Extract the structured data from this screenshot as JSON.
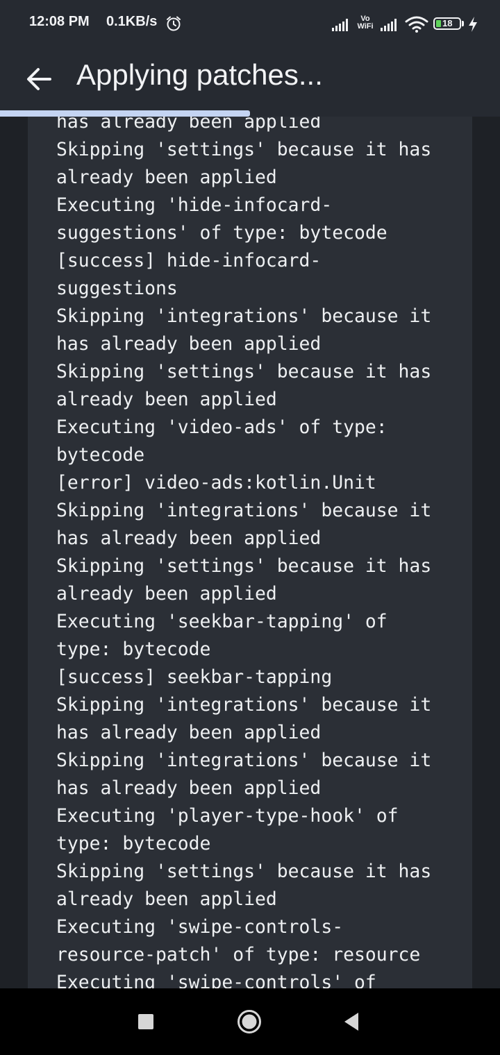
{
  "status_bar": {
    "time": "12:08 PM",
    "net_speed": "0.1KB/s",
    "vowifi_top": "Vo",
    "vowifi_bottom": "WiFi",
    "battery_level": "18",
    "icons": [
      "alarm-icon",
      "signal-icon",
      "vowifi-icon",
      "signal-icon",
      "wifi-icon",
      "battery-icon",
      "charging-icon"
    ]
  },
  "app_bar": {
    "title": "Applying patches...",
    "back_icon": "arrow-back-icon"
  },
  "progress": {
    "fraction": 0.5
  },
  "log_lines": [
    "has already been applied",
    "Skipping 'settings' because it has",
    "already been applied",
    "Executing 'hide-infocard-",
    "suggestions' of type: bytecode",
    "[success] hide-infocard-",
    "suggestions",
    "Skipping 'integrations' because it",
    "has already been applied",
    "Skipping 'settings' because it has",
    "already been applied",
    "Executing 'video-ads' of type:",
    "bytecode",
    "[error] video-ads:kotlin.Unit",
    "Skipping 'integrations' because it",
    "has already been applied",
    "Skipping 'settings' because it has",
    "already been applied",
    "Executing 'seekbar-tapping' of",
    "type: bytecode",
    "[success] seekbar-tapping",
    "Skipping 'integrations' because it",
    "has already been applied",
    "Skipping 'integrations' because it",
    "has already been applied",
    "Executing 'player-type-hook' of",
    "type: bytecode",
    "Skipping 'settings' because it has",
    "already been applied",
    "Executing 'swipe-controls-",
    "resource-patch' of type: resource",
    "Executing 'swipe-controls' of"
  ],
  "nav_bar": {
    "icons": [
      "recents-square-icon",
      "home-circle-icon",
      "back-triangle-icon"
    ]
  },
  "colors": {
    "bar_background": "#262a31",
    "log_card": "#2b2f36",
    "progress_fill": "#c4d4f2",
    "battery_fill": "#5fd35a"
  }
}
